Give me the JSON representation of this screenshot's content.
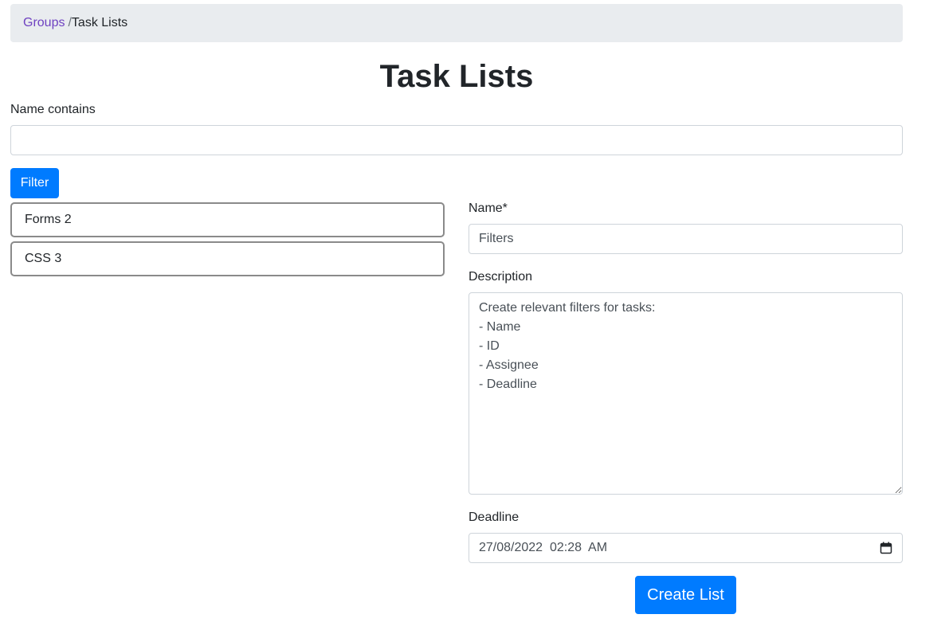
{
  "breadcrumb": {
    "link": "Groups",
    "separator": "/",
    "current": "Task Lists"
  },
  "page": {
    "title": "Task Lists"
  },
  "filter": {
    "label": "Name contains",
    "value": "",
    "button": "Filter"
  },
  "lists": [
    {
      "label": "Forms 2"
    },
    {
      "label": "CSS 3"
    }
  ],
  "form": {
    "name_label": "Name*",
    "name_value": "Filters",
    "description_label": "Description",
    "description_value": "Create relevant filters for tasks:\n- Name\n- ID\n- Assignee\n- Deadline",
    "deadline_label": "Deadline",
    "deadline_value": "27/08/2022  02:28  AM",
    "submit": "Create List"
  },
  "colors": {
    "primary": "#007bff",
    "breadcrumb_bg": "#e9ecef",
    "link": "#6f42c1"
  },
  "icons": {
    "calendar": "calendar-icon"
  }
}
